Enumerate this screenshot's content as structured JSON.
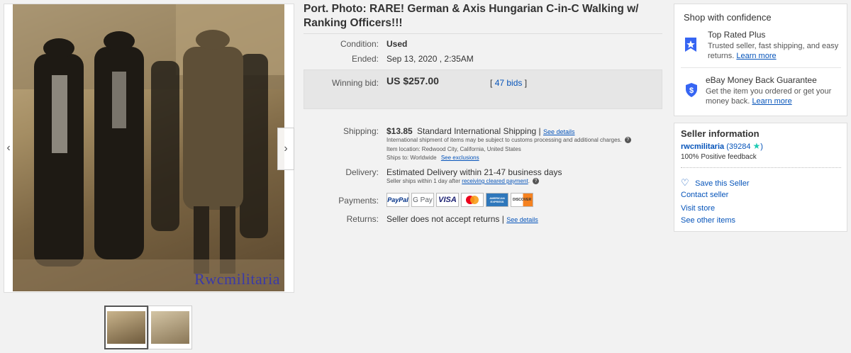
{
  "listing": {
    "title": "Port. Photo: RARE! German & Axis Hungarian C-in-C Walking w/ Ranking Officers!!!",
    "watermark": "Rwcmilitaria"
  },
  "details": {
    "condition_label": "Condition:",
    "condition_value": "Used",
    "ended_label": "Ended:",
    "ended_value": "Sep 13, 2020 , 2:35AM",
    "winning_bid_label": "Winning bid:",
    "winning_bid_value": "US $257.00",
    "bids_open": "[",
    "bids_link": "47 bids",
    "bids_close": "]"
  },
  "shipping": {
    "label": "Shipping:",
    "price": "$13.85",
    "method": "Standard International Shipping",
    "sep": "|",
    "see_details": "See details",
    "note": "International shipment of items may be subject to customs processing and additional charges.",
    "location": "Item location:  Redwood City, California, United States",
    "ships_to_label": "Ships to:",
    "ships_to_value": "Worldwide",
    "see_exclusions": "See exclusions"
  },
  "delivery": {
    "label": "Delivery:",
    "value": "Estimated Delivery within 21-47 business days",
    "note_prefix": "Seller ships within 1 day after",
    "note_link": "receiving cleared payment",
    "note_suffix": "."
  },
  "payments": {
    "label": "Payments:",
    "methods": [
      "PayPal",
      "G Pay",
      "VISA",
      "",
      "AMERICAN EXPRESS",
      "DISCOVER"
    ]
  },
  "returns": {
    "label": "Returns:",
    "value": "Seller does not accept returns",
    "sep": "|",
    "see_details": "See details"
  },
  "confidence": {
    "title": "Shop with confidence",
    "top_rated_title": "Top Rated Plus",
    "top_rated_desc": "Trusted seller, fast shipping, and easy returns.",
    "top_rated_link": "Learn more",
    "guarantee_title": "eBay Money Back Guarantee",
    "guarantee_desc": "Get the item you ordered or get your money back.",
    "guarantee_link": "Learn more"
  },
  "seller": {
    "title": "Seller information",
    "name": "rwcmilitaria",
    "score": "(39284",
    "score_close": ")",
    "feedback": "100% Positive feedback",
    "save": "Save this Seller",
    "contact": "Contact seller",
    "visit": "Visit store",
    "other": "See other items"
  },
  "colors": {
    "link": "#0654ba",
    "paypal": "#003087",
    "visa": "#1a1f71",
    "mastercard_red": "#eb001b",
    "mastercard_yellow": "#f79e1b",
    "amex": "#2e77bb",
    "discover": "#f58220"
  }
}
